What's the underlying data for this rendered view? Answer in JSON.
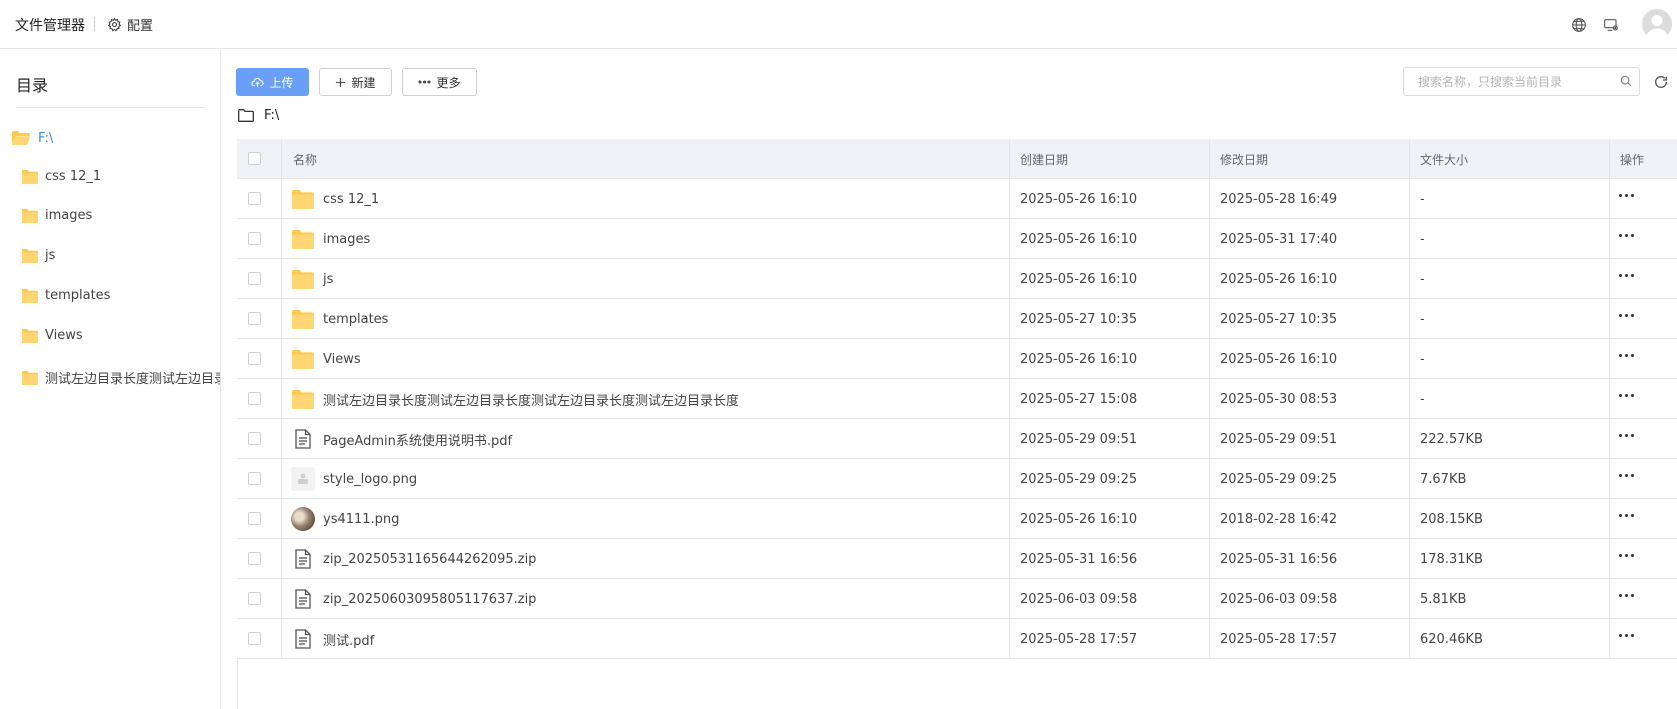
{
  "header": {
    "app_title": "文件管理器",
    "config_label": "配置"
  },
  "sidebar": {
    "title": "目录",
    "root": "F:\\",
    "items": [
      {
        "label": "css 12_1"
      },
      {
        "label": "images"
      },
      {
        "label": "js"
      },
      {
        "label": "templates"
      },
      {
        "label": "Views"
      },
      {
        "label": "测试左边目录长度测试左边目录长度测试左边目录长度测试左边目录长度"
      }
    ]
  },
  "toolbar": {
    "upload_label": "上传",
    "new_label": "新建",
    "more_label": "更多"
  },
  "search": {
    "placeholder": "搜索名称，只搜索当前目录"
  },
  "path": {
    "current": "F:\\"
  },
  "table": {
    "headers": {
      "name": "名称",
      "created": "创建日期",
      "modified": "修改日期",
      "size": "文件大小",
      "actions": "操作"
    },
    "rows": [
      {
        "name": "css 12_1",
        "icon": "folder-icon",
        "created": "2025-05-26 16:10",
        "modified": "2025-05-28 16:49",
        "size": "-"
      },
      {
        "name": "images",
        "icon": "folder-icon",
        "created": "2025-05-26 16:10",
        "modified": "2025-05-31 17:40",
        "size": "-"
      },
      {
        "name": "js",
        "icon": "folder-icon",
        "created": "2025-05-26 16:10",
        "modified": "2025-05-26 16:10",
        "size": "-"
      },
      {
        "name": "templates",
        "icon": "folder-icon",
        "created": "2025-05-27 10:35",
        "modified": "2025-05-27 10:35",
        "size": "-"
      },
      {
        "name": "Views",
        "icon": "folder-icon",
        "created": "2025-05-26 16:10",
        "modified": "2025-05-26 16:10",
        "size": "-"
      },
      {
        "name": "测试左边目录长度测试左边目录长度测试左边目录长度测试左边目录长度",
        "icon": "folder-icon",
        "created": "2025-05-27 15:08",
        "modified": "2025-05-30 08:53",
        "size": "-"
      },
      {
        "name": "PageAdmin系统使用说明书.pdf",
        "icon": "document-icon",
        "created": "2025-05-29 09:51",
        "modified": "2025-05-29 09:51",
        "size": "222.57KB"
      },
      {
        "name": "style_logo.png",
        "icon": "image-thumbnail-icon",
        "created": "2025-05-29 09:25",
        "modified": "2025-05-29 09:25",
        "size": "7.67KB"
      },
      {
        "name": "ys4111.png",
        "icon": "photo-thumbnail-icon",
        "created": "2025-05-26 16:10",
        "modified": "2018-02-28 16:42",
        "size": "208.15KB"
      },
      {
        "name": "zip_20250531165644262095.zip",
        "icon": "document-icon",
        "created": "2025-05-31 16:56",
        "modified": "2025-05-31 16:56",
        "size": "178.31KB"
      },
      {
        "name": "zip_20250603095805117637.zip",
        "icon": "document-icon",
        "created": "2025-06-03 09:58",
        "modified": "2025-06-03 09:58",
        "size": "5.81KB"
      },
      {
        "name": "测试.pdf",
        "icon": "document-icon",
        "created": "2025-05-28 17:57",
        "modified": "2025-05-28 17:57",
        "size": "620.46KB"
      }
    ]
  },
  "colors": {
    "accent": "#3b8af5",
    "primary_button": "#6a9ff7",
    "folder": "#ffc94d",
    "header_row": "#f0f1f4"
  }
}
